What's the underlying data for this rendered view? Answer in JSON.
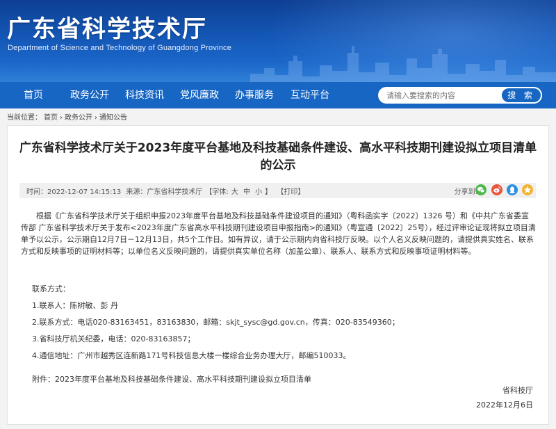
{
  "header": {
    "title": "广东省科学技术厅",
    "subtitle": "Department of Science and Technology of Guangdong Province"
  },
  "nav": {
    "items": [
      "首页",
      "政务公开",
      "科技资讯",
      "党风廉政",
      "办事服务",
      "互动平台"
    ],
    "search_placeholder": "请输入要搜索的内容",
    "search_button": "搜 索"
  },
  "breadcrumb": {
    "prefix": "当前位置：",
    "items": [
      "首页",
      "政务公开",
      "通知公告"
    ],
    "separator": "›"
  },
  "article": {
    "title_line1": "广东省科学技术厅关于2023年度平台基地及科技基础条件建设、高水平科技期刊建设拟立项目清单",
    "title_line2": "的公示",
    "meta": {
      "time": "时间：2022-12-07 14:15:13",
      "source": "来源：广东省科学技术厅",
      "font_label": "【字体:",
      "font_big": "大",
      "font_mid": "中",
      "font_small": "小",
      "font_end": "】",
      "print": "【打印】",
      "share": "分享到:"
    },
    "body": "根据《广东省科学技术厅关于组织申报2023年度平台基地及科技基础条件建设项目的通知》（粤科函实字〔2022〕1326 号）和《中共广东省委宣传部 广东省科学技术厅关于发布<2023年度广东省高水平科技期刊建设项目申报指南>的通知》（粤宣通〔2022〕25号），经过评审论证现将拟立项目清单予以公示，公示期自12月7日－12月13日，共5个工作日。如有异议，请于公示期内向省科技厅反映。以个人名义反映问题的，请提供真实姓名、联系方式和反映事项的证明材料等；以单位名义反映问题的，请提供真实单位名称（加盖公章）、联系人、联系方式和反映事项证明材料等。",
    "contact_title": "联系方式：",
    "contacts": [
      "1.联系人：陈树敏、彭 丹",
      "2.联系方式：电话020-83163451，83163830，邮箱：skjt_sysc@gd.gov.cn，传真：020-83549360；",
      "3.省科技厅机关纪委，电话：020-83163857；",
      "4.通信地址：广州市越秀区连新路171号科技信息大楼一楼综合业务办理大厅，邮编510033。"
    ],
    "attachment": "附件：2023年度平台基地及科技基础条件建设、高水平科技期刊建设拟立项目清单",
    "signature": "省科技厅",
    "date": "2022年12月6日"
  },
  "colors": {
    "nav_bg": "#1766c4",
    "wechat": "#4cb84c",
    "weibo": "#e8543c",
    "qq": "#2a8fe0",
    "favorite": "#f2b330"
  }
}
